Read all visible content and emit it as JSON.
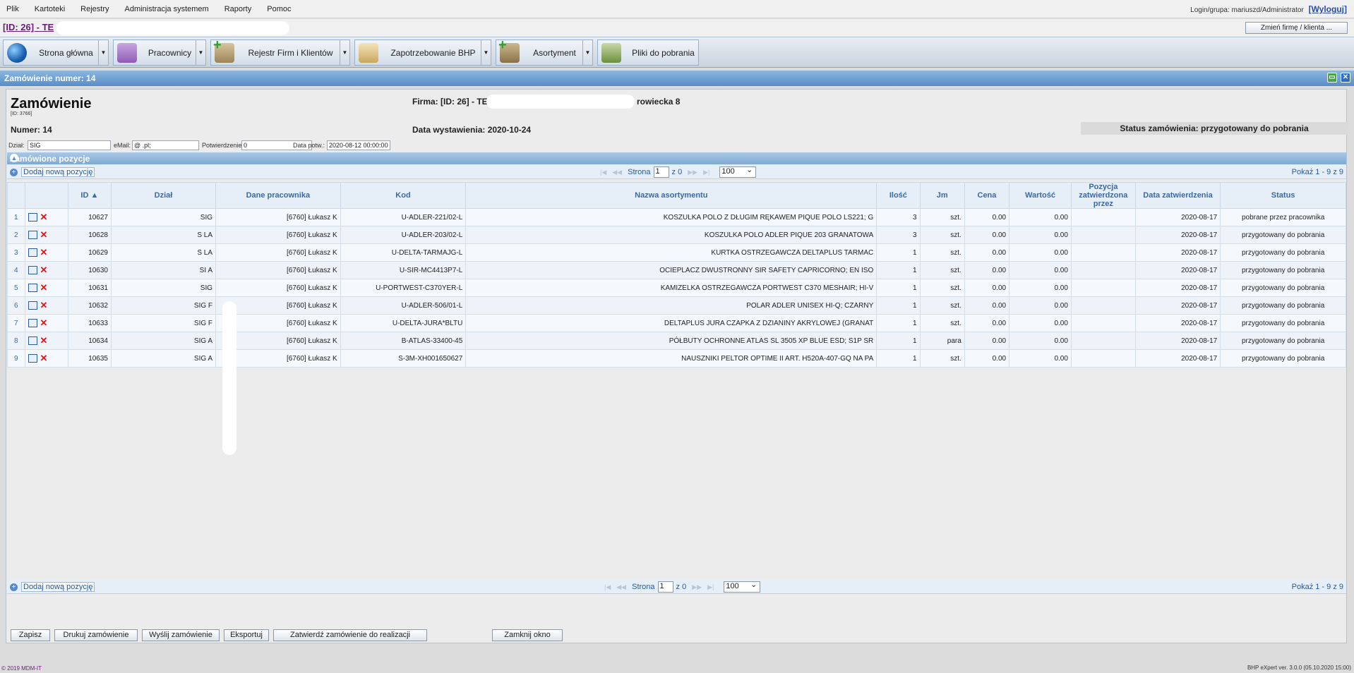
{
  "menu": {
    "items": [
      "Plik",
      "Kartoteki",
      "Rejestry",
      "Administracja systemem",
      "Raporty",
      "Pomoc"
    ],
    "login_label": "Login/grupa: mariuszd/Administrator",
    "logout": "[Wyloguj]"
  },
  "company": {
    "label": "[ID: 26] - TE",
    "change_button": "Zmień firmę / klienta ..."
  },
  "toolbar": {
    "home": "Strona główna",
    "employees": "Pracownicy",
    "registry": "Rejestr Firm i Klientów",
    "demand": "Zapotrzebowanie BHP",
    "assortment": "Asortyment",
    "downloads": "Pliki do pobrania"
  },
  "window": {
    "title": "Zamówienie numer: 14"
  },
  "order": {
    "heading": "Zamówienie",
    "id_small": "[ID: 3766]",
    "number": "Numer: 14",
    "firma": "Firma: [ID: 26] - TE",
    "address": "rowiecka 8",
    "issue_date": "Data wystawienia: 2020-10-24",
    "status": "Status zamówienia: przygotowany do pobrania"
  },
  "fields": {
    "dzial_label": "Dział:",
    "dzial_value": "SIG",
    "email_label": "eMail:",
    "email_value": "@        .pl;",
    "potw_label": "Potwierdzenie:",
    "potw_value": "0",
    "datapotw_label": "Data potw.:",
    "datapotw_value": "2020-08-12 00:00:00"
  },
  "grid": {
    "section_title": "Zamówione pozycje",
    "add_label": "Dodaj nową pozycję",
    "page_label": "Strona",
    "page_value": "1",
    "of_label": "z 0",
    "per_page": "100",
    "showing": "Pokaż 1 - 9 z 9",
    "columns": [
      "",
      "",
      "ID",
      "Dział",
      "Dane pracownika",
      "Kod",
      "Nazwa asortymentu",
      "Ilość",
      "Jm",
      "Cena",
      "Wartość",
      "Pozycja zatwierdzona przez",
      "Data zatwierdzenia",
      "Status"
    ],
    "rows": [
      {
        "n": "1",
        "id": "10627",
        "dzial": "SIG",
        "emp": "[6760] Łukasz K",
        "kod": "U-ADLER-221/02-L",
        "nazwa": "KOSZULKA POLO Z DŁUGIM RĘKAWEM PIQUE POLO LS221; G",
        "ilosc": "3",
        "jm": "szt.",
        "cena": "0.00",
        "wartosc": "0.00",
        "zatw": "",
        "data": "2020-08-17",
        "status": "pobrane przez pracownika"
      },
      {
        "n": "2",
        "id": "10628",
        "dzial": "S   LA",
        "emp": "[6760] Łukasz K",
        "kod": "U-ADLER-203/02-L",
        "nazwa": "KOSZULKA POLO ADLER PIQUE 203 GRANATOWA",
        "ilosc": "3",
        "jm": "szt.",
        "cena": "0.00",
        "wartosc": "0.00",
        "zatw": "",
        "data": "2020-08-17",
        "status": "przygotowany do pobrania"
      },
      {
        "n": "3",
        "id": "10629",
        "dzial": "S   LA",
        "emp": "[6760] Łukasz K",
        "kod": "U-DELTA-TARMAJG-L",
        "nazwa": "KURTKA OSTRZEGAWCZA DELTAPLUS TARMAC",
        "ilosc": "1",
        "jm": "szt.",
        "cena": "0.00",
        "wartosc": "0.00",
        "zatw": "",
        "data": "2020-08-17",
        "status": "przygotowany do pobrania"
      },
      {
        "n": "4",
        "id": "10630",
        "dzial": "SI   A",
        "emp": "[6760] Łukasz K",
        "kod": "U-SIR-MC4413P7-L",
        "nazwa": "OCIEPLACZ DWUSTRONNY SIR SAFETY CAPRICORNO; EN ISO",
        "ilosc": "1",
        "jm": "szt.",
        "cena": "0.00",
        "wartosc": "0.00",
        "zatw": "",
        "data": "2020-08-17",
        "status": "przygotowany do pobrania"
      },
      {
        "n": "5",
        "id": "10631",
        "dzial": "SIG",
        "emp": "[6760] Łukasz K",
        "kod": "U-PORTWEST-C370YER-L",
        "nazwa": "KAMIZELKA OSTRZEGAWCZA PORTWEST C370 MESHAIR; HI-V",
        "ilosc": "1",
        "jm": "szt.",
        "cena": "0.00",
        "wartosc": "0.00",
        "zatw": "",
        "data": "2020-08-17",
        "status": "przygotowany do pobrania"
      },
      {
        "n": "6",
        "id": "10632",
        "dzial": "SIG F",
        "emp": "[6760] Łukasz K",
        "kod": "U-ADLER-506/01-L",
        "nazwa": "POLAR ADLER UNISEX HI-Q; CZARNY",
        "ilosc": "1",
        "jm": "szt.",
        "cena": "0.00",
        "wartosc": "0.00",
        "zatw": "",
        "data": "2020-08-17",
        "status": "przygotowany do pobrania"
      },
      {
        "n": "7",
        "id": "10633",
        "dzial": "SIG F",
        "emp": "[6760] Łukasz K",
        "kod": "U-DELTA-JURA*BLTU",
        "nazwa": "DELTAPLUS JURA CZAPKA Z DZIANINY AKRYLOWEJ (GRANAT",
        "ilosc": "1",
        "jm": "szt.",
        "cena": "0.00",
        "wartosc": "0.00",
        "zatw": "",
        "data": "2020-08-17",
        "status": "przygotowany do pobrania"
      },
      {
        "n": "8",
        "id": "10634",
        "dzial": "SIG   A",
        "emp": "[6760] Łukasz K",
        "kod": "B-ATLAS-33400-45",
        "nazwa": "PÓŁBUTY OCHRONNE ATLAS SL 3505 XP BLUE ESD; S1P SR",
        "ilosc": "1",
        "jm": "para",
        "cena": "0.00",
        "wartosc": "0.00",
        "zatw": "",
        "data": "2020-08-17",
        "status": "przygotowany do pobrania"
      },
      {
        "n": "9",
        "id": "10635",
        "dzial": "SIG   A",
        "emp": "[6760] Łukasz K",
        "kod": "S-3M-XH001650627",
        "nazwa": "NAUSZNIKI PELTOR OPTIME II ART. H520A-407-GQ NA PA",
        "ilosc": "1",
        "jm": "szt.",
        "cena": "0.00",
        "wartosc": "0.00",
        "zatw": "",
        "data": "2020-08-17",
        "status": "przygotowany do pobrania"
      }
    ]
  },
  "buttons": {
    "save": "Zapisz",
    "print": "Drukuj zamówienie",
    "send": "Wyślij zamówienie",
    "export": "Eksportuj",
    "approve": "Zatwierdź zamówienie do realizacji",
    "close": "Zamknij okno"
  },
  "status": {
    "copyright": "© 2019 MDM-IT",
    "version": "BHP eXpert ver. 3.0.0 (05.10.2020 15:00)"
  }
}
